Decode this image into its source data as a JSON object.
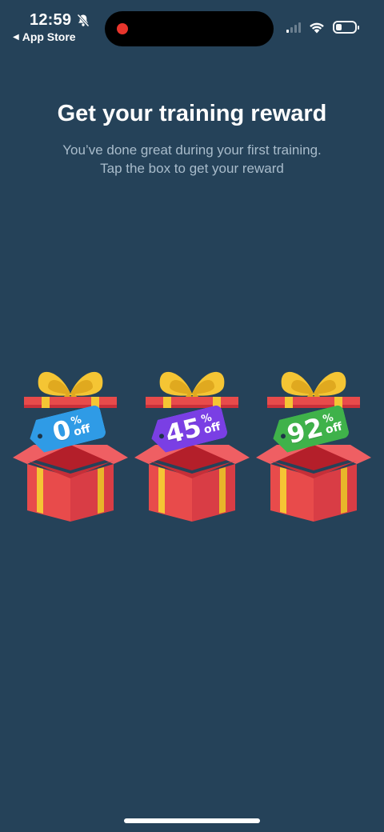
{
  "status_bar": {
    "time": "12:59",
    "back_label": "App Store",
    "battery_level": 0.3,
    "signal_bars_active": 1,
    "icons": [
      "bell-slash-icon",
      "cellular-signal-icon",
      "wifi-icon",
      "battery-icon"
    ]
  },
  "header": {
    "title": "Get your training reward",
    "subtitle_line1": "You’ve done great during your first training.",
    "subtitle_line2": "Tap the box to get your reward"
  },
  "gifts": [
    {
      "value": "0",
      "percent_sign": "%",
      "off_label": "off",
      "tag_color": "#2f9be6"
    },
    {
      "value": "45",
      "percent_sign": "%",
      "off_label": "off",
      "tag_color": "#7a3fe4"
    },
    {
      "value": "92",
      "percent_sign": "%",
      "off_label": "off",
      "tag_color": "#3fb24a"
    }
  ],
  "colors": {
    "background": "#254259",
    "box_red": "#e84b4b",
    "ribbon_yellow": "#f5c534"
  }
}
